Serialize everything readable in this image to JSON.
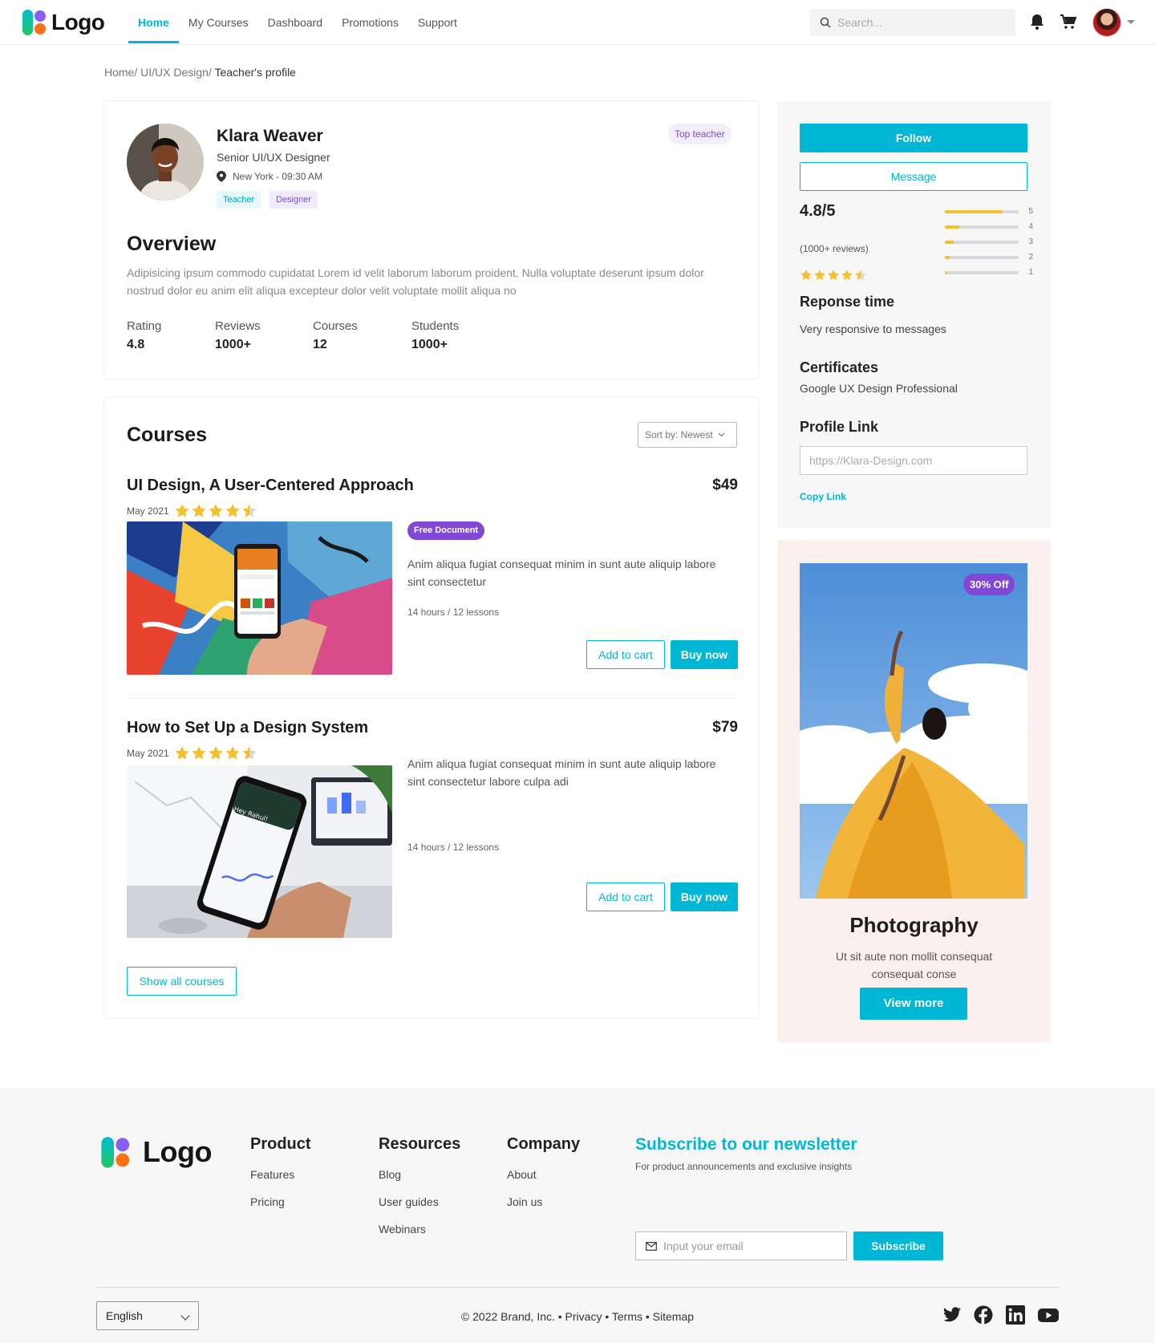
{
  "nav": {
    "logo_text": "Logo",
    "links": [
      "Home",
      "My Courses",
      "Dashboard",
      "Promotions",
      "Support"
    ],
    "active_index": 0,
    "search_placeholder": "Search..."
  },
  "breadcrumb": {
    "parts": "Home/ UI/UX Design/",
    "current": "Teacher's profile"
  },
  "profile": {
    "name": "Klara Weaver",
    "role": "Senior UI/UX Designer",
    "location": "New York - 09:30 AM",
    "chips": [
      "Teacher",
      "Designer"
    ],
    "top_badge": "Top teacher",
    "overview_title": "Overview",
    "overview_text": "Adipisicing ipsum commodo cupidatat Lorem id velit laborum laborum proident. Nulla voluptate deserunt ipsum dolor nostrud dolor eu anim elit aliqua excepteur dolor velit voluptate mollit aliqua no",
    "stats": [
      {
        "label": "Rating",
        "value": "4.8"
      },
      {
        "label": "Reviews",
        "value": "1000+"
      },
      {
        "label": "Courses",
        "value": "12"
      },
      {
        "label": "Students",
        "value": "1000+"
      }
    ]
  },
  "courses": {
    "title": "Courses",
    "sort_label": "Sort by: Newest",
    "items": [
      {
        "title": "UI Design, A User-Centered Approach",
        "price": "$49",
        "date": "May 2021",
        "stars": 4.5,
        "badge": "Free Document",
        "desc": "Anim aliqua fugiat consequat minim in sunt aute aliquip labore sint consectetur",
        "meta": "14 hours / 12 lessons",
        "cart_label": "Add to cart",
        "buy_label": "Buy now"
      },
      {
        "title": "How to Set Up a Design System",
        "price": "$79",
        "date": "May 2021",
        "stars": 4.5,
        "desc": "Anim aliqua fugiat consequat minim in sunt aute aliquip labore sint consectetur labore culpa adi",
        "meta": "14 hours / 12 lessons",
        "cart_label": "Add to cart",
        "buy_label": "Buy now",
        "phone_text": "Hey Rahul!"
      }
    ],
    "show_all_label": "Show all courses"
  },
  "sidebar": {
    "follow_label": "Follow",
    "message_label": "Message",
    "rating_big": "4.8/5",
    "rating_count": "(1000+ reviews)",
    "rating_stars": 4.5,
    "rating_bars": [
      {
        "label": "5",
        "fraction": 0.78
      },
      {
        "label": "4",
        "fraction": 0.2
      },
      {
        "label": "3",
        "fraction": 0.12
      },
      {
        "label": "2",
        "fraction": 0.07
      },
      {
        "label": "1",
        "fraction": 0.03
      }
    ],
    "response_title": "Reponse time",
    "response_text": "Very responsive to messages",
    "cert_title": "Certificates",
    "cert_text": "Google UX Design Professional",
    "link_title": "Profile Link",
    "link_value": "https://Klara-Design.com",
    "copy_label": "Copy Link"
  },
  "promo": {
    "badge": "30% Off",
    "title": "Photography",
    "text": "Ut sit aute non mollit consequat consequat conse",
    "button": "View more"
  },
  "footer": {
    "logo_text": "Logo",
    "columns": [
      {
        "title": "Product",
        "links": [
          "Features",
          "Pricing"
        ]
      },
      {
        "title": "Resources",
        "links": [
          "Blog",
          "User guides",
          "Webinars"
        ]
      },
      {
        "title": "Company",
        "links": [
          "About",
          "Join us"
        ]
      }
    ],
    "newsletter_title": "Subscribe to our newsletter",
    "newsletter_sub": "For product announcements and exclusive insights",
    "email_placeholder": "Input your email",
    "subscribe_label": "Subscribe",
    "language": "English",
    "copyright": "© 2022 Brand, Inc. • Privacy • Terms • Sitemap",
    "social": [
      "twitter-icon",
      "facebook-icon",
      "linkedin-icon",
      "youtube-icon"
    ]
  },
  "colors": {
    "accent": "#00b7d6",
    "purple": "#8147d6",
    "star": "#f5c02d"
  }
}
